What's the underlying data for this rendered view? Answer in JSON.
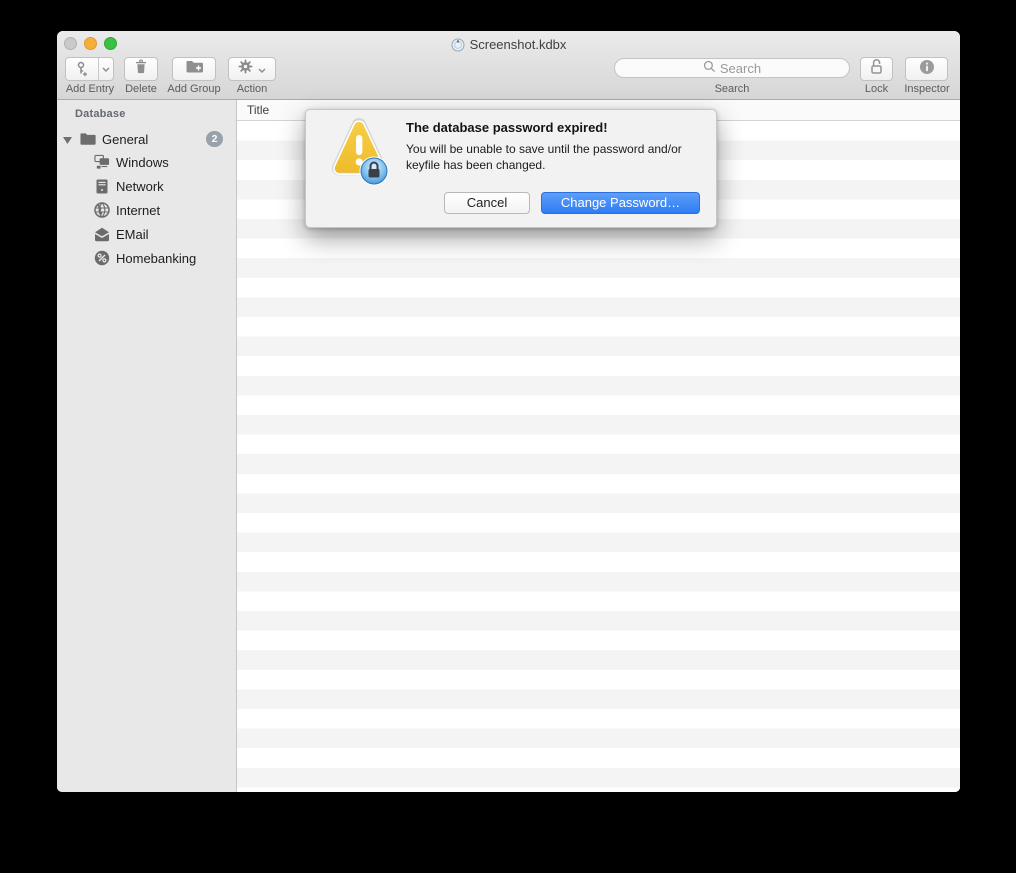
{
  "window": {
    "title": "Screenshot.kdbx"
  },
  "toolbar": {
    "add_entry": {
      "label": "Add Entry",
      "icon": "key-plus-icon"
    },
    "delete": {
      "label": "Delete",
      "icon": "trash-icon"
    },
    "add_group": {
      "label": "Add Group",
      "icon": "folder-plus-icon"
    },
    "action": {
      "label": "Action",
      "icon": "gear-icon"
    },
    "search": {
      "label": "Search",
      "placeholder": "Search",
      "icon": "magnifier-icon"
    },
    "lock": {
      "label": "Lock",
      "icon": "open-padlock-icon"
    },
    "inspector": {
      "label": "Inspector",
      "icon": "info-icon"
    }
  },
  "sidebar": {
    "header": "Database",
    "group": {
      "label": "General",
      "badge": "2",
      "icon": "folder-icon",
      "expanded": true
    },
    "items": [
      {
        "label": "Windows",
        "icon": "workgroup-icon"
      },
      {
        "label": "Network",
        "icon": "server-icon"
      },
      {
        "label": "Internet",
        "icon": "globe-icon"
      },
      {
        "label": "EMail",
        "icon": "envelope-icon"
      },
      {
        "label": "Homebanking",
        "icon": "percent-icon"
      }
    ]
  },
  "table": {
    "columns": [
      {
        "label": "Title"
      }
    ]
  },
  "dialog": {
    "icon": "warning-lock-icon",
    "title": "The database password expired!",
    "message_lines": [
      "You will be unable to save until the password and/or",
      "keyfile has been changed."
    ],
    "buttons": {
      "cancel": "Cancel",
      "confirm": "Change Password…"
    }
  },
  "colors": {
    "accent_blue": "#2e7cf4",
    "warning_yellow": "#f2c233",
    "badge_gray": "#99a1ab",
    "traffic_gray": "#cacaca",
    "traffic_orange": "#f6ae3b",
    "traffic_green": "#3cc043"
  }
}
